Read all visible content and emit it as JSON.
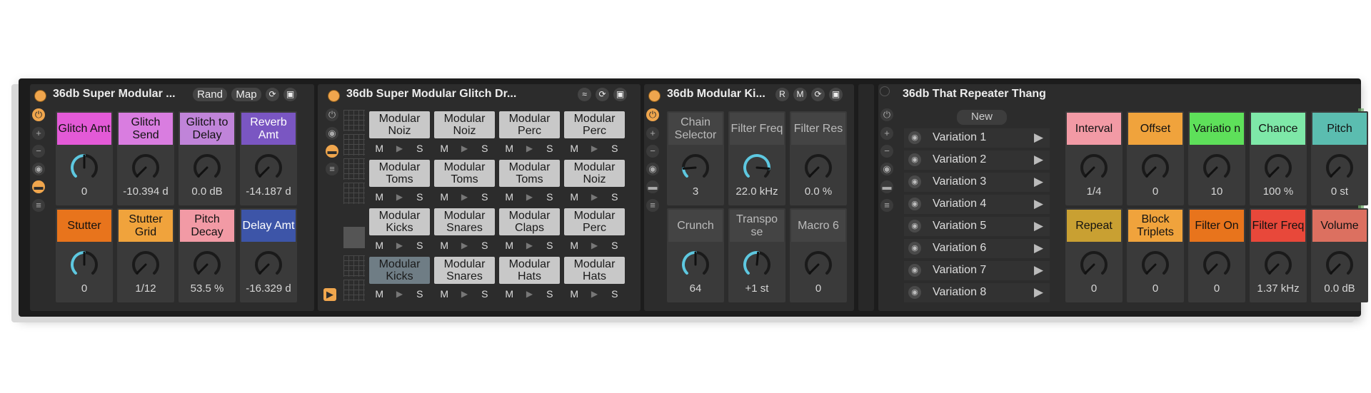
{
  "devices": [
    {
      "title": "36db Super Modular ...",
      "buttons": {
        "rand": "Rand",
        "map": "Map"
      },
      "macros": [
        {
          "label": "Glitch Amt",
          "value": "0",
          "color": "#e35ad7",
          "level": 0.5
        },
        {
          "label": "Glitch Send",
          "value": "-10.394 d",
          "color": "#d97de0",
          "level": 0.0
        },
        {
          "label": "Glitch to Delay",
          "value": "0.0 dB",
          "color": "#c084d9",
          "level": 0.0
        },
        {
          "label": "Reverb Amt",
          "value": "-14.187 d",
          "color": "#7a56c2",
          "level": 0.0
        },
        {
          "label": "Stutter",
          "value": "0",
          "color": "#e8741c",
          "level": 0.5
        },
        {
          "label": "Stutter Grid",
          "value": "1/12",
          "color": "#f0a33c",
          "level": 0.0
        },
        {
          "label": "Pitch Decay",
          "value": "53.5 %",
          "color": "#f29aa5",
          "level": 0.0
        },
        {
          "label": "Delay Amt",
          "value": "-16.329 d",
          "color": "#3d55a8",
          "level": 0.0
        }
      ]
    },
    {
      "title": "36db Super Modular Glitch Dr...",
      "pads": [
        {
          "label": "Modular Noiz"
        },
        {
          "label": "Modular Noiz"
        },
        {
          "label": "Modular Perc"
        },
        {
          "label": "Modular Perc"
        },
        {
          "label": "Modular Toms"
        },
        {
          "label": "Modular Toms"
        },
        {
          "label": "Modular Toms"
        },
        {
          "label": "Modular Noiz"
        },
        {
          "label": "Modular Kicks"
        },
        {
          "label": "Modular Snares"
        },
        {
          "label": "Modular Claps"
        },
        {
          "label": "Modular Perc"
        },
        {
          "label": "Modular Kicks"
        },
        {
          "label": "Modular Snares"
        },
        {
          "label": "Modular Hats"
        },
        {
          "label": "Modular Hats"
        }
      ],
      "pad_controls": {
        "mute": "M",
        "solo": "S"
      }
    },
    {
      "title": "36db Modular Ki...",
      "buttons": {
        "r": "R",
        "m": "M"
      },
      "macros": [
        {
          "label": "Chain Selector",
          "value": "3",
          "level": 0.15
        },
        {
          "label": "Filter Freq",
          "value": "22.0 kHz",
          "level": 0.85
        },
        {
          "label": "Filter Res",
          "value": "0.0 %",
          "level": 0.0
        },
        {
          "label": "Crunch",
          "value": "64",
          "level": 0.5
        },
        {
          "label": "Transpo se",
          "value": "+1 st",
          "level": 0.52
        },
        {
          "label": "Macro 6",
          "value": "0",
          "level": 0.0
        }
      ]
    },
    {
      "title": "36db That Repeater Thang",
      "new_label": "New",
      "variations": [
        "Variation 1",
        "Variation 2",
        "Variation 3",
        "Variation 4",
        "Variation 5",
        "Variation 6",
        "Variation 7",
        "Variation 8"
      ],
      "macros": [
        {
          "label": "Interval",
          "value": "1/4",
          "color": "#f29aa5"
        },
        {
          "label": "Offset",
          "value": "0",
          "color": "#f0a33c"
        },
        {
          "label": "Variatio n",
          "value": "10",
          "color": "#5ee05a"
        },
        {
          "label": "Chance",
          "value": "100 %",
          "color": "#7ee8a8"
        },
        {
          "label": "Pitch",
          "value": "0 st",
          "color": "#5bbdb0"
        },
        {
          "label": "Repeat",
          "value": "0",
          "color": "#c9a032"
        },
        {
          "label": "Block Triplets",
          "value": "0",
          "color": "#f0a33c"
        },
        {
          "label": "Filter On",
          "value": "0",
          "color": "#e8741c"
        },
        {
          "label": "Filter Freq",
          "value": "1.37 kHz",
          "color": "#e8483a"
        },
        {
          "label": "Volume",
          "value": "0.0 dB",
          "color": "#dc7060"
        }
      ]
    }
  ]
}
